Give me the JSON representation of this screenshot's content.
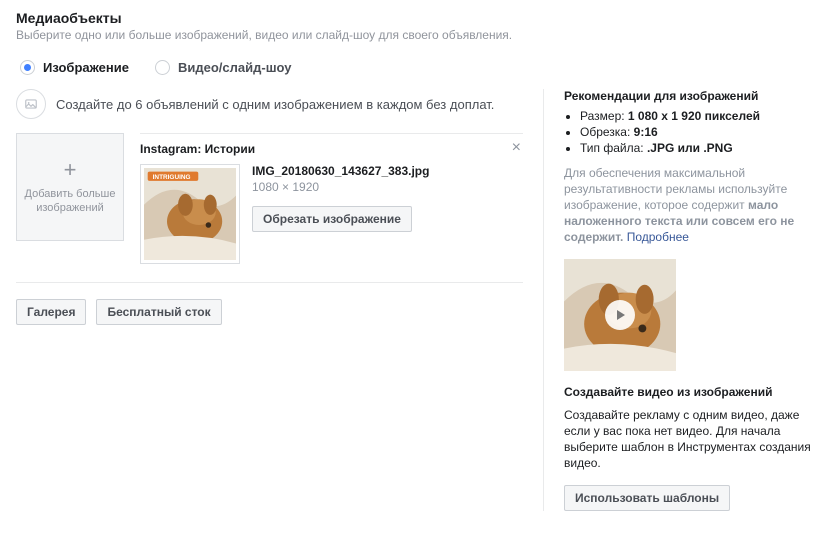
{
  "header": {
    "title": "Медиаобъекты",
    "subtitle": "Выберите одно или больше изображений, видео или слайд-шоу для своего объявления."
  },
  "tabs": {
    "image": "Изображение",
    "video": "Видео/слайд-шоу"
  },
  "tip": "Создайте до 6 объявлений с одним изображением в каждом без доплат.",
  "add_box": {
    "line1": "Добавить больше",
    "line2": "изображений"
  },
  "card": {
    "title": "Instagram: Истории",
    "filename": "IMG_20180630_143627_383.jpg",
    "dimensions": "1080 × 1920",
    "crop_btn": "Обрезать изображение"
  },
  "actions": {
    "gallery": "Галерея",
    "stock": "Бесплатный сток"
  },
  "rec": {
    "title": "Рекомендации для изображений",
    "size_label": "Размер:",
    "size_value": "1 080 x 1 920 пикселей",
    "crop_label": "Обрезка:",
    "crop_value": "9:16",
    "type_label": "Тип файла:",
    "type_value": ".JPG или .PNG",
    "desc_pre": "Для обеспечения максимальной результативности рекламы используйте изображение, которое содержит ",
    "desc_bold": "мало наложенного текста или совсем его не содержит.",
    "more": "Подробнее"
  },
  "promo": {
    "title": "Создавайте видео из изображений",
    "desc": "Создавайте рекламу с одним видео, даже если у вас пока нет видео. Для начала выберите шаблон в Инструментах создания видео.",
    "btn": "Использовать шаблоны"
  }
}
